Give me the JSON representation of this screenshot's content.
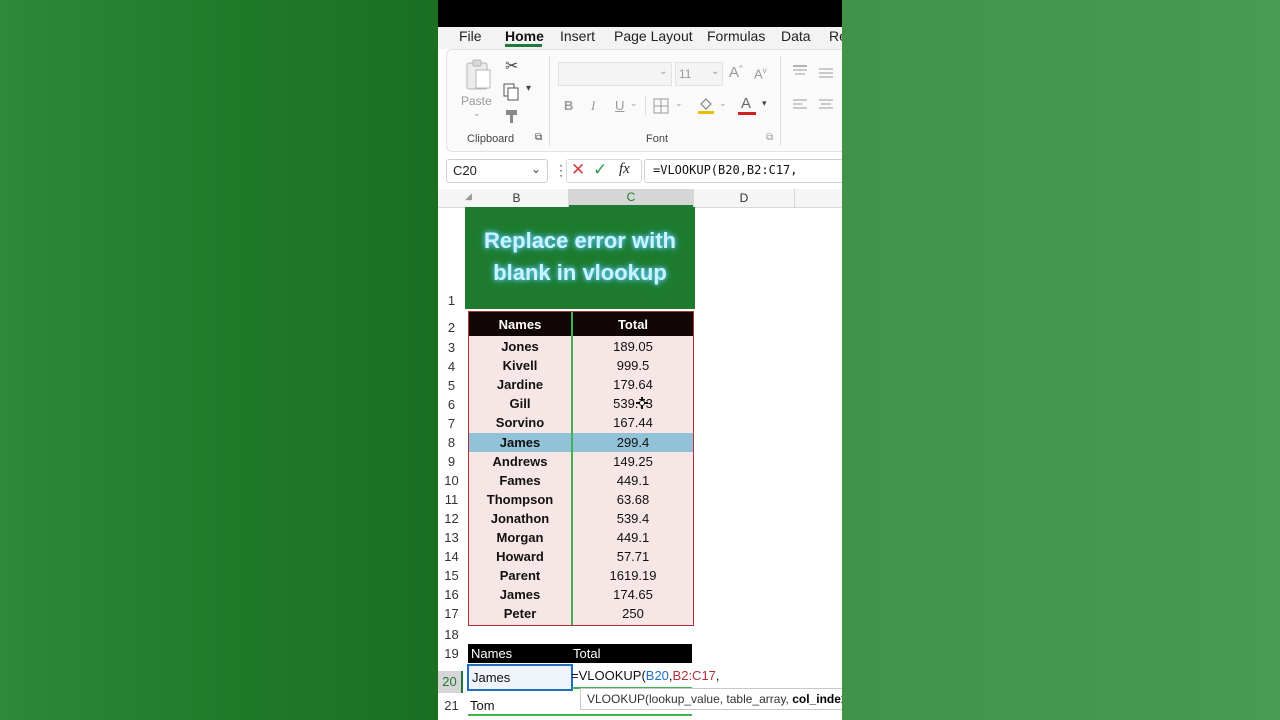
{
  "ribbon": {
    "tabs": [
      "File",
      "Home",
      "Insert",
      "Page Layout",
      "Formulas",
      "Data",
      "Re"
    ],
    "active_tab": "Home",
    "clipboard": {
      "paste_label": "Paste",
      "group_label": "Clipboard"
    },
    "font": {
      "font_size": "11",
      "grow_label": "A",
      "shrink_label": "A",
      "bold": "B",
      "italic": "I",
      "underline": "U",
      "font_color_label": "A",
      "group_label": "Font"
    }
  },
  "formula_bar": {
    "cell_ref": "C20",
    "fx_label": "fx",
    "formula": "=VLOOKUP(B20,B2:C17,"
  },
  "columns": [
    "B",
    "C",
    "D"
  ],
  "rows": [
    "1",
    "2",
    "3",
    "4",
    "5",
    "6",
    "7",
    "8",
    "9",
    "10",
    "11",
    "12",
    "13",
    "14",
    "15",
    "16",
    "17",
    "18",
    "19",
    "20",
    "21"
  ],
  "title": {
    "line1": "Replace error with",
    "line2": "blank in vlookup"
  },
  "table": {
    "headers": [
      "Names",
      "Total"
    ],
    "rows": [
      {
        "name": "Jones",
        "total": "189.05"
      },
      {
        "name": "Kivell",
        "total": "999.5"
      },
      {
        "name": "Jardine",
        "total": "179.64"
      },
      {
        "name": "Gill",
        "total": "539.73"
      },
      {
        "name": "Sorvino",
        "total": "167.44"
      },
      {
        "name": "James",
        "total": "299.4"
      },
      {
        "name": "Andrews",
        "total": "149.25"
      },
      {
        "name": "Fames",
        "total": "449.1"
      },
      {
        "name": "Thompson",
        "total": "63.68"
      },
      {
        "name": "Jonathon",
        "total": "539.4"
      },
      {
        "name": "Morgan",
        "total": "449.1"
      },
      {
        "name": "Howard",
        "total": "57.71"
      },
      {
        "name": "Parent",
        "total": "1619.19"
      },
      {
        "name": "James",
        "total": "174.65"
      },
      {
        "name": "Peter",
        "total": "250"
      }
    ],
    "highlighted_row_index": 5
  },
  "lookup": {
    "headers": [
      "Names",
      "Total"
    ],
    "row20_name": "James",
    "row20_formula": {
      "prefix": "=VLOOKUP(",
      "arg1": "B20",
      "comma1": ",",
      "arg2": "B2:C17",
      "comma2": ","
    },
    "row21_name": "Tom"
  },
  "tooltip": {
    "text": "VLOOKUP(lookup_value, table_array, ",
    "bold": "col_index_n"
  },
  "colors": {
    "excel_green": "#1e7b2e",
    "table_border": "#b0303a",
    "highlight": "#92c2d8",
    "selection_blue": "#1e6fbf"
  }
}
